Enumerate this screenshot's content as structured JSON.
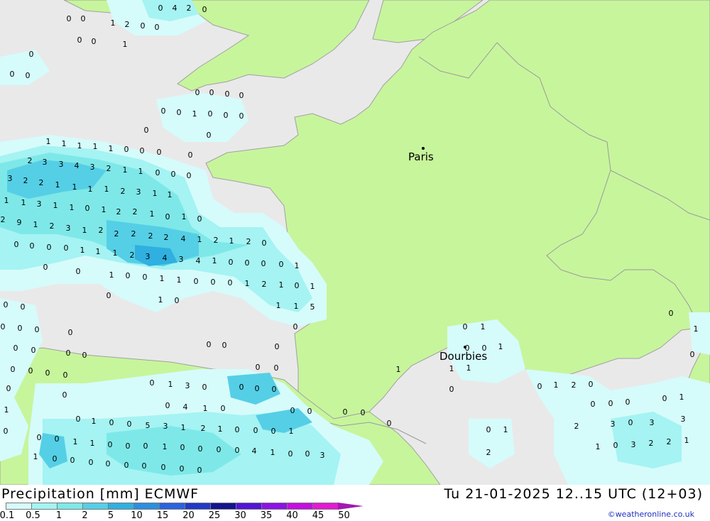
{
  "map": {
    "cities": [
      {
        "name": "Paris"
      },
      {
        "name": "Dourbies"
      }
    ],
    "grid_values": [
      "0",
      "4",
      "2",
      "0",
      "0",
      "0",
      "1",
      "2",
      "0",
      "0",
      "0",
      "0",
      "1",
      "0",
      "0",
      "0",
      "0",
      "0",
      "0",
      "0",
      "0",
      "0",
      "1",
      "0",
      "0",
      "0",
      "0",
      "0",
      "1",
      "1",
      "1",
      "1",
      "1",
      "0",
      "0",
      "0",
      "0",
      "2",
      "3",
      "3",
      "4",
      "3",
      "2",
      "1",
      "1",
      "0",
      "0",
      "0",
      "3",
      "2",
      "2",
      "1",
      "1",
      "1",
      "1",
      "2",
      "3",
      "1",
      "1",
      "1",
      "1",
      "3",
      "1",
      "1",
      "0",
      "1",
      "2",
      "2",
      "1",
      "0",
      "1",
      "0",
      "2",
      "9",
      "1",
      "2",
      "3",
      "1",
      "2",
      "2",
      "2",
      "2",
      "2",
      "4",
      "1",
      "2",
      "1",
      "2",
      "0",
      "0",
      "0",
      "0",
      "0",
      "1",
      "1",
      "1",
      "2",
      "3",
      "4",
      "3",
      "4",
      "1",
      "0",
      "0",
      "0",
      "0",
      "1",
      "0",
      "0",
      "1",
      "0",
      "0",
      "1",
      "1",
      "0",
      "0",
      "0",
      "1",
      "2",
      "1",
      "0",
      "1",
      "0",
      "1",
      "0",
      "1",
      "1",
      "5",
      "0",
      "0",
      "0",
      "0",
      "0",
      "0",
      "0",
      "0",
      "0",
      "0",
      "0",
      "0",
      "0",
      "0",
      "0",
      "0",
      "0",
      "0",
      "0",
      "0",
      "1",
      "0",
      "1",
      "0",
      "0",
      "1",
      "1",
      "1",
      "0",
      "1",
      "3",
      "0",
      "0",
      "0",
      "0",
      "0",
      "0",
      "0",
      "0",
      "1",
      "2",
      "0",
      "0",
      "1",
      "0",
      "0",
      "4",
      "1",
      "0",
      "0",
      "0",
      "0",
      "0",
      "0",
      "0",
      "0",
      "0",
      "1",
      "1",
      "0",
      "0",
      "1",
      "0",
      "0",
      "5",
      "3",
      "1",
      "2",
      "1",
      "0",
      "0",
      "0",
      "1",
      "0",
      "0",
      "1",
      "2",
      "3",
      "0",
      "3",
      "3",
      "0",
      "0",
      "1",
      "1",
      "0",
      "0",
      "0",
      "1",
      "0",
      "0",
      "0",
      "0",
      "4",
      "1",
      "0",
      "0",
      "3",
      "2",
      "1",
      "0",
      "3",
      "2",
      "2",
      "1",
      "1",
      "0",
      "0",
      "0",
      "0",
      "0",
      "0",
      "0",
      "0",
      "0"
    ]
  },
  "footer": {
    "title": "Precipitation [mm] ECMWF",
    "datetime": "Tu 21-01-2025 12..15 UTC (12+03)",
    "credit": "©weatheronline.co.uk",
    "legend": [
      {
        "label": "0.1",
        "color": "#d6fbfb"
      },
      {
        "label": "0.5",
        "color": "#a5f3f3"
      },
      {
        "label": "1",
        "color": "#7ee8e8"
      },
      {
        "label": "2",
        "color": "#55cfe6"
      },
      {
        "label": "5",
        "color": "#2fb0e0"
      },
      {
        "label": "10",
        "color": "#2b8ee0"
      },
      {
        "label": "15",
        "color": "#2a62df"
      },
      {
        "label": "20",
        "color": "#2238c8"
      },
      {
        "label": "25",
        "color": "#14148f"
      },
      {
        "label": "30",
        "color": "#5214d8"
      },
      {
        "label": "35",
        "color": "#8c14e6"
      },
      {
        "label": "40",
        "color": "#c40fe0"
      },
      {
        "label": "45",
        "color": "#e419d4"
      },
      {
        "label": "50",
        "color": "#a01aaf"
      }
    ]
  }
}
